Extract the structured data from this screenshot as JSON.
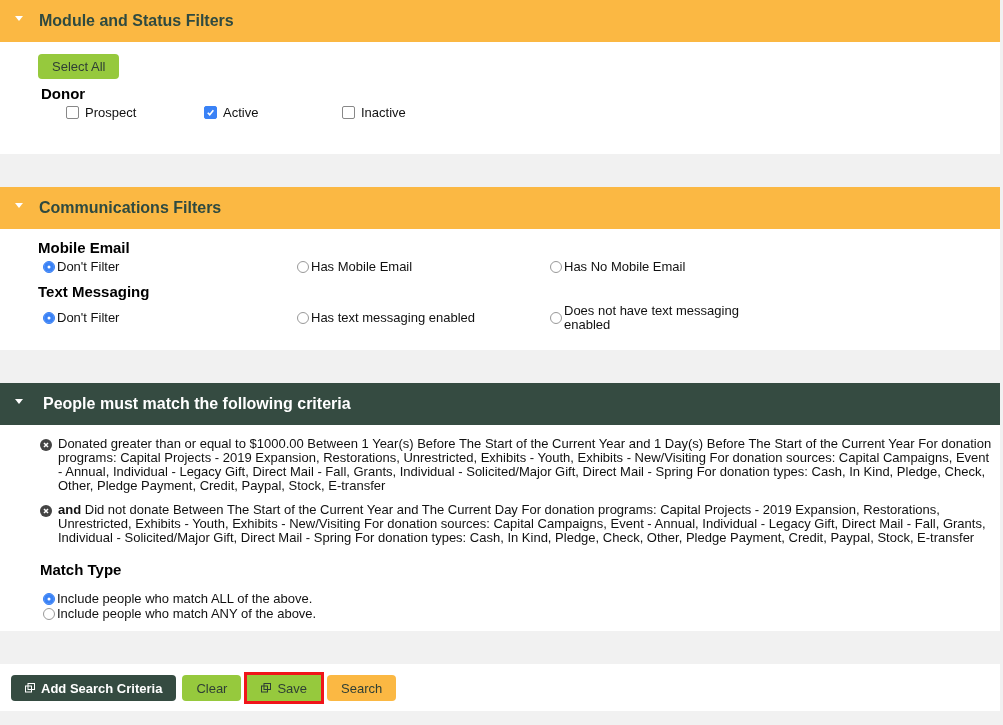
{
  "module_filters": {
    "title": "Module and Status Filters",
    "expanded": true,
    "select_all": "Select All",
    "group": "Donor",
    "options": [
      {
        "label": "Prospect",
        "checked": false
      },
      {
        "label": "Active",
        "checked": true
      },
      {
        "label": "Inactive",
        "checked": false
      }
    ]
  },
  "communications_filters": {
    "title": "Communications Filters",
    "expanded": true,
    "groups": [
      {
        "label": "Mobile Email",
        "options": [
          {
            "label": "Don't Filter",
            "selected": true
          },
          {
            "label": "Has Mobile Email",
            "selected": false
          },
          {
            "label": "Has No Mobile Email",
            "selected": false
          }
        ]
      },
      {
        "label": "Text Messaging",
        "options": [
          {
            "label": "Don't Filter",
            "selected": true
          },
          {
            "label": "Has text messaging enabled",
            "selected": false
          },
          {
            "label": "Does not have text messaging enabled",
            "selected": false
          }
        ]
      }
    ]
  },
  "criteria": {
    "title": "People must match the following criteria",
    "expanded": true,
    "items": [
      "Donated greater than or equal to $1000.00 Between 1 Year(s) Before The Start of the Current Year and 1 Day(s) Before The Start of the Current Year For donation programs: Capital Projects - 2019 Expansion, Restorations, Unrestricted, Exhibits - Youth, Exhibits - New/Visiting For donation sources: Capital Campaigns, Event - Annual, Individual - Legacy Gift, Direct Mail - Fall, Grants, Individual - Solicited/Major Gift, Direct Mail - Spring For donation types: Cash, In Kind, Pledge, Check, Other, Pledge Payment, Credit, Paypal, Stock, E-transfer",
      "**and** Did not donate Between The Start of the Current Year and The Current Day For donation programs: Capital Projects - 2019 Expansion, Restorations, Unrestricted, Exhibits - Youth, Exhibits - New/Visiting For donation sources: Capital Campaigns, Event - Annual, Individual - Legacy Gift, Direct Mail - Fall, Grants, Individual - Solicited/Major Gift, Direct Mail - Spring For donation types: Cash, In Kind, Pledge, Check, Other, Pledge Payment, Credit, Paypal, Stock, E-transfer"
    ],
    "match_type": {
      "label": "Match Type",
      "options": [
        {
          "label": "Include people who match ALL of the above.",
          "selected": true
        },
        {
          "label": "Include people who match ANY of the above.",
          "selected": false
        }
      ]
    }
  },
  "buttons": [
    {
      "label": "Add Search Criteria",
      "kind": "dark",
      "icon": true,
      "highlighted": false
    },
    {
      "label": "Clear",
      "kind": "green",
      "icon": false,
      "highlighted": false
    },
    {
      "label": "Save",
      "kind": "green",
      "icon": true,
      "highlighted": true
    },
    {
      "label": "Search",
      "kind": "orange",
      "icon": false,
      "highlighted": false
    }
  ]
}
